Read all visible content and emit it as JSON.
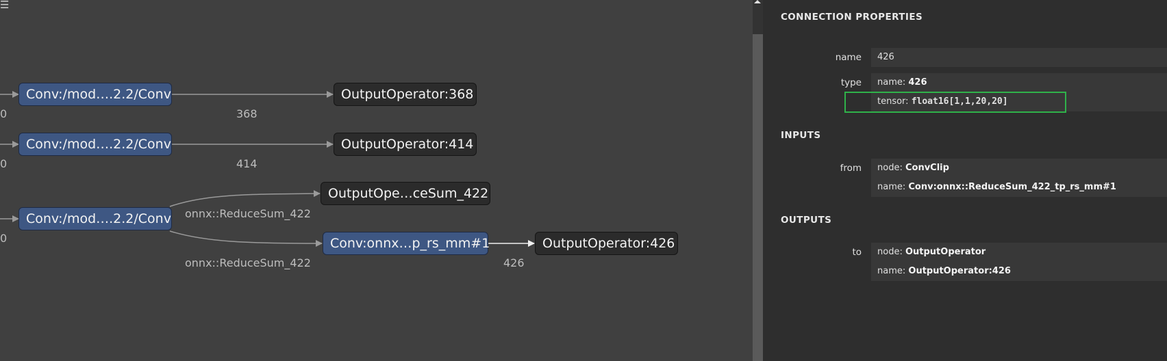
{
  "graph": {
    "nodes": {
      "conv1": "Conv:/mod….2.2/Conv",
      "conv2": "Conv:/mod….2.2/Conv",
      "conv3": "Conv:/mod….2.2/Conv",
      "out368": "OutputOperator:368",
      "out414": "OutputOperator:414",
      "out_reducesum": "OutputOpe…ceSum_422",
      "conv_onnx": "Conv:onnx…p_rs_mm#1",
      "out426": "OutputOperator:426"
    },
    "edge_labels": {
      "e368": "368",
      "e414": "414",
      "reducesum_top": "onnx::ReduceSum_422",
      "reducesum_bottom": "onnx::ReduceSum_422",
      "e426": "426",
      "left1": "0",
      "left2": "0",
      "left3": "0"
    },
    "menu_icon": "☰"
  },
  "panel": {
    "title": "CONNECTION PROPERTIES",
    "name_label": "name",
    "name_value": "426",
    "type_label": "type",
    "type_name_key": "name: ",
    "type_name_value": "426",
    "type_tensor_key": "tensor: ",
    "type_tensor_value": "float16[1,1,20,20]",
    "inputs_title": "INPUTS",
    "from_label": "from",
    "from_node_key": "node: ",
    "from_node_value": "ConvClip",
    "from_name_key": "name: ",
    "from_name_value": "Conv:onnx::ReduceSum_422_tp_rs_mm#1",
    "outputs_title": "OUTPUTS",
    "to_label": "to",
    "to_node_key": "node: ",
    "to_node_value": "OutputOperator",
    "to_name_key": "name: ",
    "to_name_value": "OutputOperator:426"
  },
  "colors": {
    "canvas": "#404040",
    "conv_node": "#3e5783",
    "output_node": "#2b2b2b",
    "panel": "#2e2e2e",
    "highlight": "#2fb24a"
  }
}
